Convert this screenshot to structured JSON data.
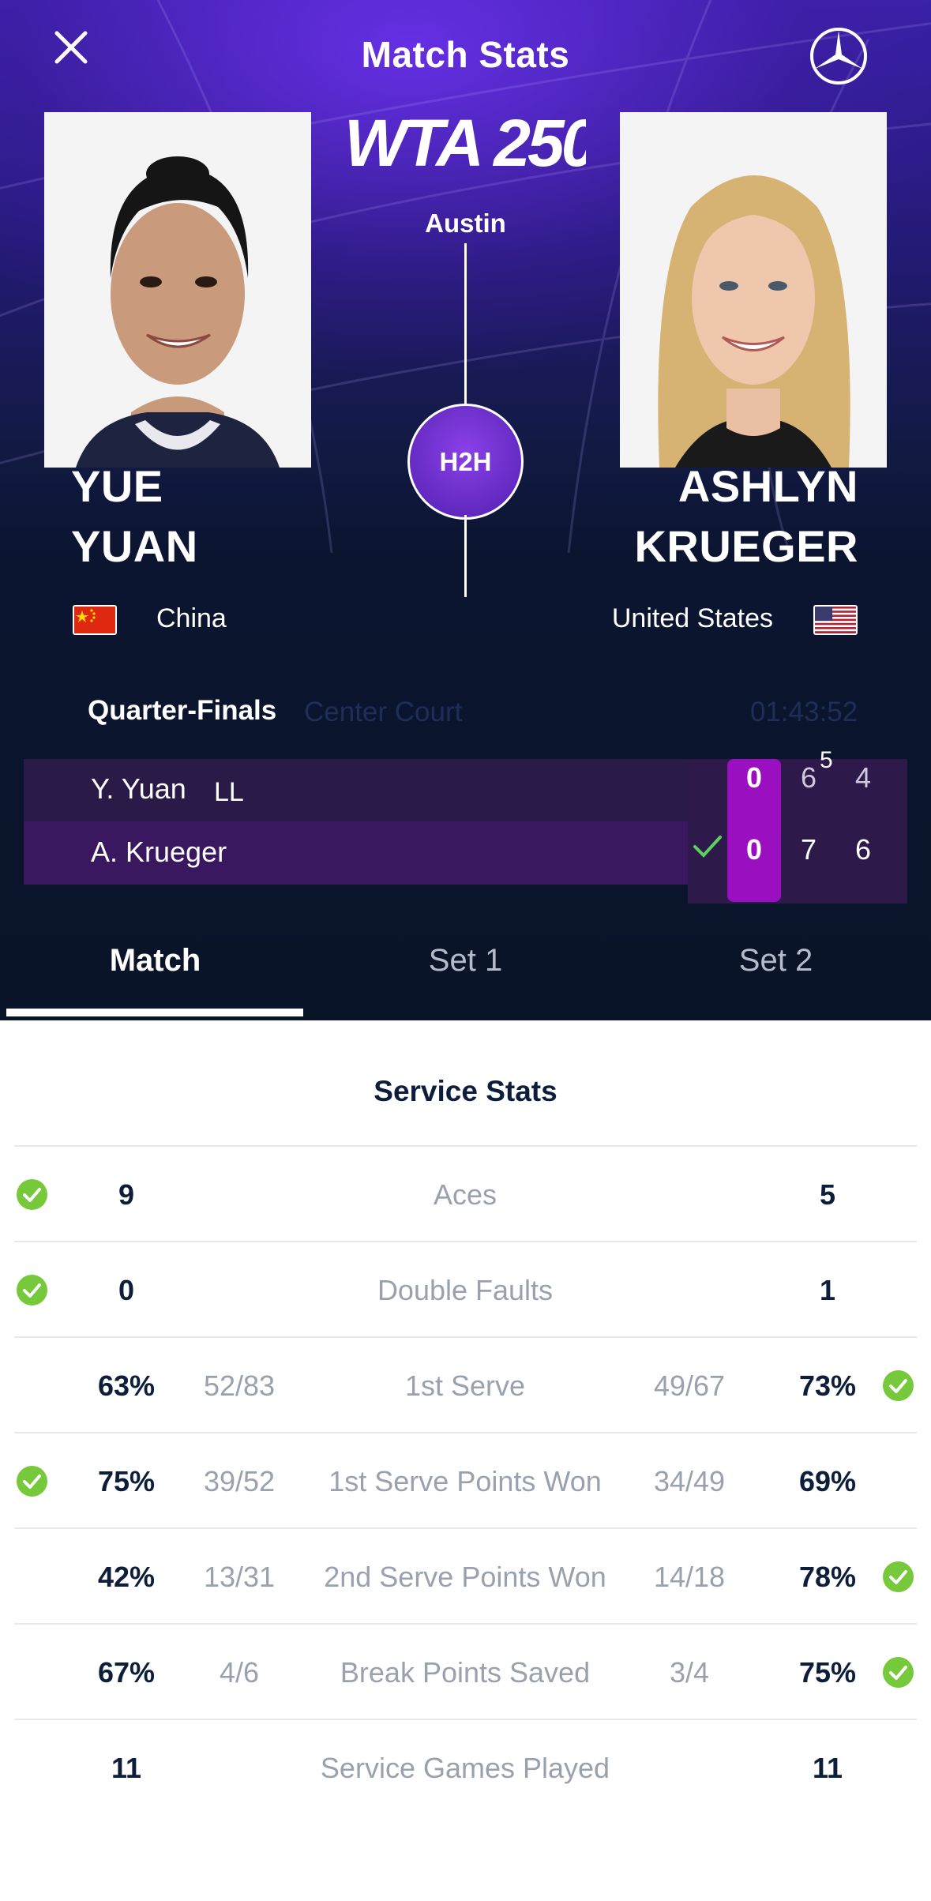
{
  "header": {
    "title": "Match Stats"
  },
  "tournament": {
    "logo_text": "WTA 250",
    "city": "Austin",
    "h2h_label": "H2H"
  },
  "player_left": {
    "first": "YUE",
    "last": "YUAN",
    "country": "China"
  },
  "player_right": {
    "first": "ASHLYN",
    "last": "KRUEGER",
    "country": "United States"
  },
  "match": {
    "round": "Quarter-Finals",
    "court": "Center Court",
    "duration": "01:43:52"
  },
  "scoreboard": {
    "rows": [
      {
        "name": "Y. Yuan",
        "tag": "LL",
        "game": "0",
        "set1": "6",
        "tiebreak": "5",
        "set2": "4"
      },
      {
        "name": "A. Krueger",
        "tag": "",
        "game": "0",
        "set1": "7",
        "set2": "6",
        "winner": true
      }
    ]
  },
  "tabs": [
    {
      "label": "Match"
    },
    {
      "label": "Set 1"
    },
    {
      "label": "Set 2"
    }
  ],
  "section": {
    "title": "Service Stats"
  },
  "stats": [
    {
      "label": "Aces",
      "left_value": "9",
      "left_fraction": "",
      "right_fraction": "",
      "right_value": "5",
      "leader": "left"
    },
    {
      "label": "Double Faults",
      "left_value": "0",
      "left_fraction": "",
      "right_fraction": "",
      "right_value": "1",
      "leader": "left"
    },
    {
      "label": "1st Serve",
      "left_value": "63%",
      "left_fraction": "52/83",
      "right_fraction": "49/67",
      "right_value": "73%",
      "leader": "right"
    },
    {
      "label": "1st Serve Points Won",
      "left_value": "75%",
      "left_fraction": "39/52",
      "right_fraction": "34/49",
      "right_value": "69%",
      "leader": "left"
    },
    {
      "label": "2nd Serve Points Won",
      "left_value": "42%",
      "left_fraction": "13/31",
      "right_fraction": "14/18",
      "right_value": "78%",
      "leader": "right"
    },
    {
      "label": "Break Points Saved",
      "left_value": "67%",
      "left_fraction": "4/6",
      "right_fraction": "3/4",
      "right_value": "75%",
      "leader": "right"
    },
    {
      "label": "Service Games Played",
      "left_value": "11",
      "left_fraction": "",
      "right_fraction": "",
      "right_value": "11",
      "leader": "none"
    }
  ],
  "colors": {
    "accent_purple": "#9a10c0",
    "check_green": "#76c93a",
    "dark_navy": "#0a1428"
  },
  "icons": {
    "close": "close-icon",
    "sponsor": "mercedes-star-icon",
    "check": "check-icon"
  }
}
